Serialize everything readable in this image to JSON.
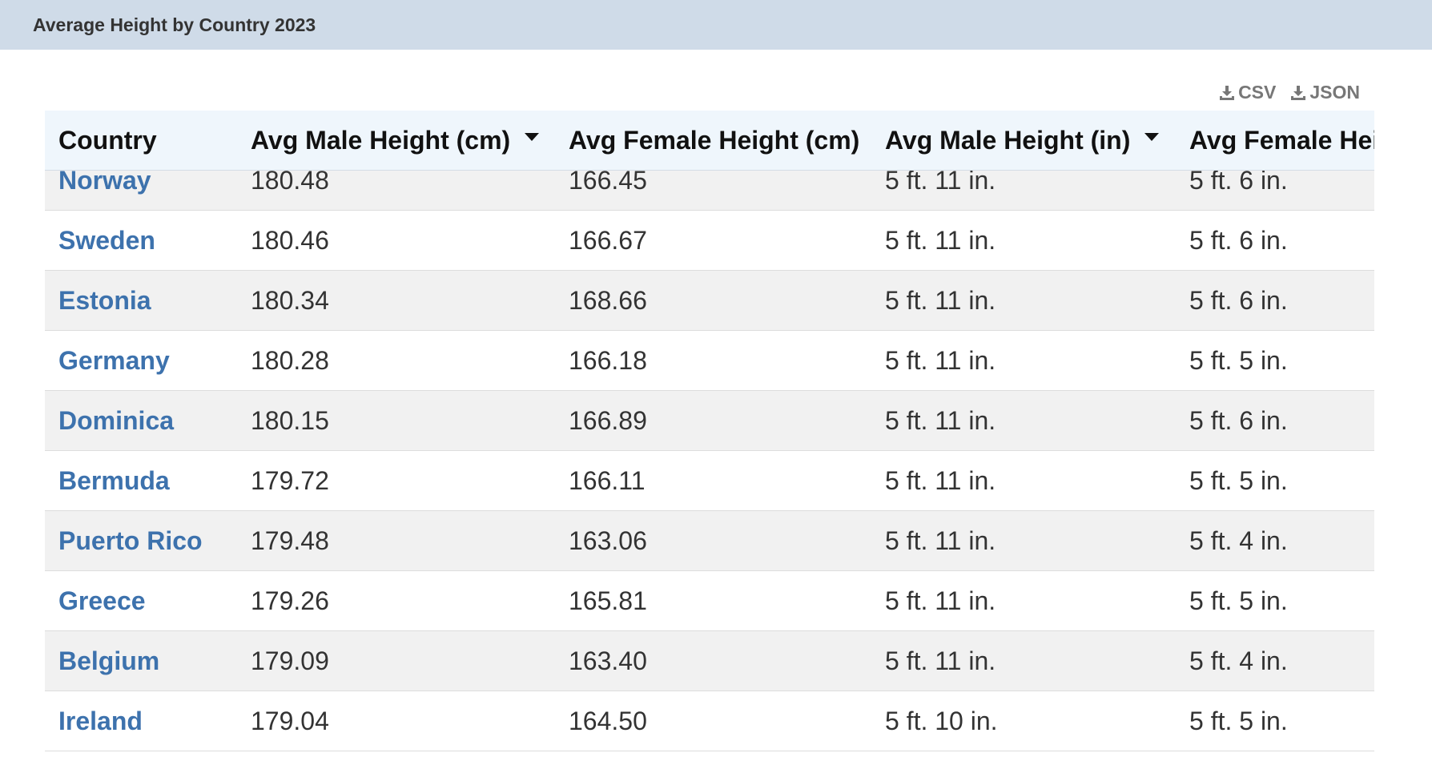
{
  "title": "Average Height by Country 2023",
  "downloads": [
    {
      "label": "CSV",
      "icon": "download-icon"
    },
    {
      "label": "JSON",
      "icon": "download-icon"
    }
  ],
  "table": {
    "headers": [
      {
        "label": "Country",
        "sortable": false
      },
      {
        "label": "Avg Male Height (cm)",
        "sortable": true
      },
      {
        "label": "Avg Female Height (cm)",
        "sortable": false
      },
      {
        "label": "Avg Male Height (in)",
        "sortable": true
      },
      {
        "label": "Avg Female Hei",
        "sortable": false
      }
    ],
    "rows": [
      [
        "Norway",
        "180.48",
        "166.45",
        "5 ft. 11 in.",
        "5 ft. 6 in."
      ],
      [
        "Sweden",
        "180.46",
        "166.67",
        "5 ft. 11 in.",
        "5 ft. 6 in."
      ],
      [
        "Estonia",
        "180.34",
        "168.66",
        "5 ft. 11 in.",
        "5 ft. 6 in."
      ],
      [
        "Germany",
        "180.28",
        "166.18",
        "5 ft. 11 in.",
        "5 ft. 5 in."
      ],
      [
        "Dominica",
        "180.15",
        "166.89",
        "5 ft. 11 in.",
        "5 ft. 6 in."
      ],
      [
        "Bermuda",
        "179.72",
        "166.11",
        "5 ft. 11 in.",
        "5 ft. 5 in."
      ],
      [
        "Puerto Rico",
        "179.48",
        "163.06",
        "5 ft. 11 in.",
        "5 ft. 4 in."
      ],
      [
        "Greece",
        "179.26",
        "165.81",
        "5 ft. 11 in.",
        "5 ft. 5 in."
      ],
      [
        "Belgium",
        "179.09",
        "163.40",
        "5 ft. 11 in.",
        "5 ft. 4 in."
      ],
      [
        "Ireland",
        "179.04",
        "164.50",
        "5 ft. 10 in.",
        "5 ft. 5 in."
      ]
    ]
  },
  "colors": {
    "title_bar": "#cfdbe8",
    "header_bg": "#eff6fc",
    "link": "#3d72ad",
    "row_stripe": "#f1f1f1"
  }
}
